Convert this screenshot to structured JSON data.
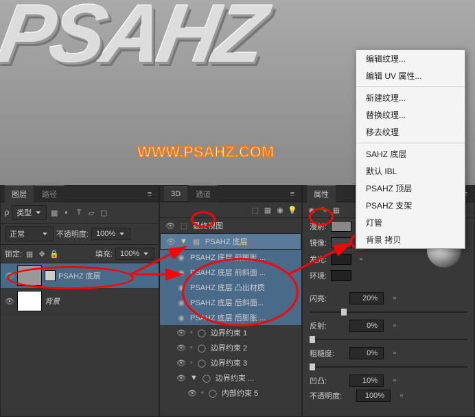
{
  "canvas": {
    "text3d": "PSAHZ",
    "watermark": "WWW.PSAHZ.COM"
  },
  "layers_panel": {
    "tab_layers": "图层",
    "tab_paths": "路径",
    "type_label": "类型",
    "blend_mode": "正常",
    "opacity_label": "不透明度:",
    "opacity_val": "100%",
    "lock_label": "锁定:",
    "fill_label": "填充:",
    "fill_val": "100%",
    "layer1": "PSAHZ 底层",
    "layer_bg": "背景"
  },
  "panel_3d": {
    "tab_3d": "3D",
    "tab_channels": "通道",
    "scene_view": "最终视图",
    "item_base": "PSAHZ 底层",
    "item_front_inflate": "PSAHZ 底层 前膨胀 ...",
    "item_front_bevel": "PSAHZ 底层 前斜面 ...",
    "item_extrude": "PSAHZ 底层 凸出材质",
    "item_back_bevel": "PSAHZ 底层 后斜面...",
    "item_back_inflate": "PSAHZ 底层 后膨胀 ...",
    "bound1": "边界约束 1",
    "bound2": "边界约束 2",
    "bound3": "边界约束 3",
    "bound4": "边界约束 ...",
    "inner": "内部约束 5"
  },
  "props_panel": {
    "tab_props": "属性",
    "diffuse": "漫射:",
    "specular": "镜像:",
    "illum": "发光:",
    "ambient": "环境:",
    "shine": "闪亮:",
    "shine_val": "20%",
    "reflect": "反射:",
    "reflect_val": "0%",
    "rough": "粗糙度:",
    "rough_val": "0%",
    "bump": "凹凸:",
    "bump_val": "10%",
    "opacity": "不透明度:",
    "opacity_val": "100%"
  },
  "ctx": {
    "edit_tex": "编辑纹理...",
    "edit_uv": "编辑 UV 属性...",
    "new_tex": "新建纹理...",
    "replace_tex": "替换纹理...",
    "remove_tex": "移去纹理",
    "i1": "SAHZ 底层",
    "i2": "默认 IBL",
    "i3": "PSAHZ 顶层",
    "i4": "PSAHZ 支架",
    "i5": "灯管",
    "i6": "背景 拷贝"
  }
}
